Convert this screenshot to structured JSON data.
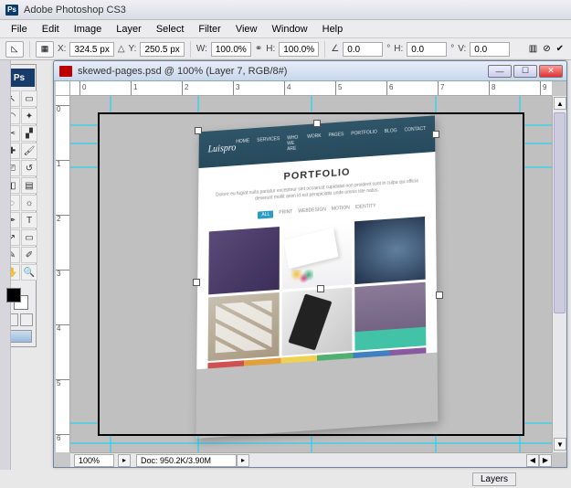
{
  "app": {
    "title": "Adobe Photoshop CS3",
    "ps_short": "Ps"
  },
  "menu": {
    "file": "File",
    "edit": "Edit",
    "image": "Image",
    "layer": "Layer",
    "select": "Select",
    "filter": "Filter",
    "view": "View",
    "window": "Window",
    "help": "Help"
  },
  "options": {
    "x_label": "X:",
    "x_value": "324.5 px",
    "y_label": "Y:",
    "y_value": "250.5 px",
    "w_label": "W:",
    "w_value": "100.0%",
    "h_label": "H:",
    "h_value": "100.0%",
    "angle_label": "∠",
    "angle_value": "0.0",
    "angle_unit": "°",
    "hskew_label": "H:",
    "hskew_value": "0.0",
    "hskew_unit": "°",
    "vskew_label": "V:",
    "vskew_value": "0.0"
  },
  "document": {
    "title": "skewed-pages.psd @ 100% (Layer 7, RGB/8#)",
    "zoom": "100%",
    "docsize": "Doc: 950.2K/3.90M"
  },
  "ruler": {
    "h_ticks": [
      "0",
      "1",
      "2",
      "3",
      "4",
      "5",
      "6",
      "7",
      "8",
      "9"
    ],
    "v_ticks": [
      "0",
      "1",
      "2",
      "3",
      "4",
      "5",
      "6"
    ]
  },
  "mockup": {
    "logo": "Luispro",
    "nav": [
      "HOME",
      "SERVICES",
      "WHO WE ARE",
      "WORK",
      "PAGES",
      "PORTFOLIO",
      "BLOG",
      "CONTACT"
    ],
    "heading": "PORTFOLIO",
    "subtitle": "Dolore eu fugiat nulla pariatur excepteur sint occaecat cupidatat non proident sunt in culpa qui officia deserunt mollit anim id est perspiciatis unde omnis iste natus.",
    "filters": {
      "all": "ALL",
      "print": "PRINT",
      "webdesign": "WEBDESIGN",
      "motion": "MOTION",
      "identity": "IDENTITY"
    }
  },
  "panel": {
    "layers_tab": "Layers"
  }
}
